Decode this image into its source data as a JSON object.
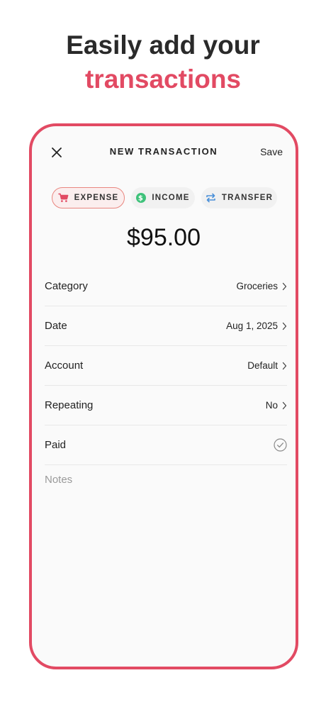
{
  "headline": {
    "line1": "Easily add your",
    "line2": "transactions"
  },
  "nav": {
    "title": "NEW TRANSACTION",
    "save_label": "Save",
    "close_icon": "close-icon"
  },
  "types": [
    {
      "label": "EXPENSE",
      "icon": "cart-icon",
      "active": true
    },
    {
      "label": "INCOME",
      "icon": "dollar-circle-icon",
      "active": false
    },
    {
      "label": "TRANSFER",
      "icon": "transfer-icon",
      "active": false
    }
  ],
  "amount": "$95.00",
  "fields": {
    "category": {
      "label": "Category",
      "value": "Groceries"
    },
    "date": {
      "label": "Date",
      "value": "Aug 1, 2025"
    },
    "account": {
      "label": "Account",
      "value": "Default"
    },
    "repeating": {
      "label": "Repeating",
      "value": "No"
    },
    "paid": {
      "label": "Paid",
      "checked": true
    }
  },
  "notes": {
    "placeholder": "Notes"
  },
  "colors": {
    "accent": "#e24a63",
    "income": "#3ec27a",
    "transfer": "#4a90d9"
  }
}
